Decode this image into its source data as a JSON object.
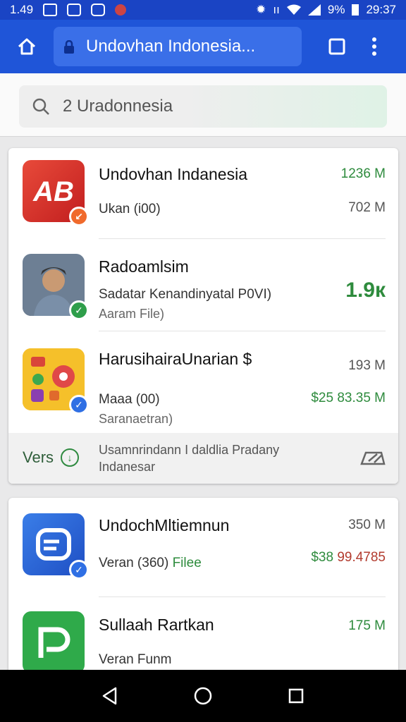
{
  "status_bar": {
    "time_left": "1.49",
    "battery": "9%",
    "time_right": "29:37"
  },
  "browser": {
    "url_text": "Undovhan Indonesia..."
  },
  "search": {
    "query": "2 Uradonnesia"
  },
  "card1": {
    "items": [
      {
        "title": "Undovhan Indanesia",
        "subtitle": "Ukan (i00)",
        "value_top": "1236 M",
        "value_bottom": "702 M",
        "badge": "↙"
      },
      {
        "title": "Radoamlsim",
        "subtitle": "Sadatar Kenandinyatal P0VI)",
        "subtitle2": "Aaram File)",
        "value": "1.9к",
        "badge": "✓"
      },
      {
        "title": "HarusihairaUnarian $",
        "subtitle": "Maaa (00)",
        "subtitle2": "Saranaetran)",
        "value_top": "193 M",
        "value_bottom": "$25 83.35 M",
        "badge": "✓"
      }
    ],
    "footer": {
      "vers_label": "Vers",
      "vers_icon_glyph": "↓",
      "text_line1": "Usamnrindann I daldlia Pradany",
      "text_line2": "Indanesar"
    }
  },
  "card2": {
    "items": [
      {
        "title": "UndochMltiemnun",
        "subtitle_a": "Veran (360)",
        "subtitle_b": "Filee",
        "value_top": "350 M",
        "value_bottom_green": "$38",
        "value_bottom_red": "99.4785",
        "badge": "✓"
      },
      {
        "title": "Sullaah Rartkan",
        "subtitle": "Veran Funm",
        "value_top": "175 M"
      }
    ]
  },
  "colors": {
    "primary": "#1f55d8",
    "status": "#1a44c4",
    "green": "#2e8b3d",
    "red": "#b23b2e"
  }
}
